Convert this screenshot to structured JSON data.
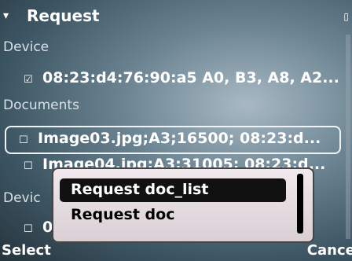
{
  "status": {
    "title": "Request",
    "signal_icon": "signal-antenna-icon",
    "battery_icon": "battery-icon"
  },
  "sections": {
    "device_header": "Device",
    "documents_header": "Documents",
    "device2_header": "Devic"
  },
  "device_item": {
    "text": "08:23:d4:76:90:a5 A0, B3, A8, A2..."
  },
  "document_items": [
    {
      "text": "Image03.jpg;A3;16500; 08:23:d..."
    },
    {
      "text": "Image04.jpg;A3;31005; 08:23:d..."
    }
  ],
  "device2_item": {
    "text": "0"
  },
  "popup": {
    "items": [
      {
        "label": "Request doc_list"
      },
      {
        "label": "Request doc"
      }
    ]
  },
  "softkeys": {
    "left": "Select",
    "right": "Cancel"
  }
}
